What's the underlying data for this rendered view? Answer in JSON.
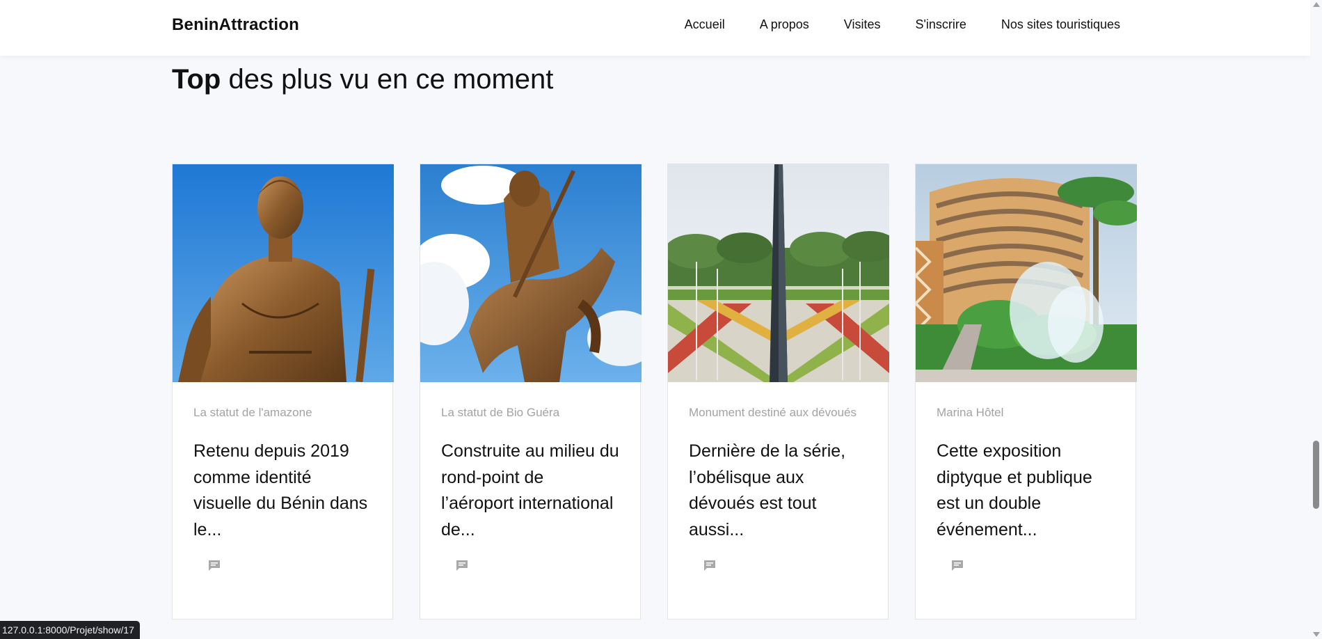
{
  "navbar": {
    "brand": "BeninAttraction",
    "links": [
      "Accueil",
      "A propos",
      "Visites",
      "S'inscrire",
      "Nos sites touristiques"
    ]
  },
  "section": {
    "title_bold": "Top",
    "title_rest": " des plus vu en ce moment"
  },
  "cards": [
    {
      "category": "La statut de l'amazone",
      "text": "Retenu depuis 2019 comme identité visuelle du Bénin dans le...",
      "image_icon": "amazone-statue-image",
      "comment_icon": "comment-icon"
    },
    {
      "category": "La statut de Bio Guéra",
      "text": "Construite au milieu du rond-point de l’aéroport international de...",
      "image_icon": "bio-guera-statue-image",
      "comment_icon": "comment-icon"
    },
    {
      "category": "Monument destiné aux dévoués",
      "text": "Dernière de la série, l’obélisque aux dévoués est tout aussi...",
      "image_icon": "obelisk-monument-image",
      "comment_icon": "comment-icon"
    },
    {
      "category": "Marina Hôtel",
      "text": "Cette exposition diptyque et publique est un double événement...",
      "image_icon": "marina-hotel-image",
      "comment_icon": "comment-icon"
    }
  ],
  "status_bar": {
    "url": "127.0.0.1:8000/Projet/show/17"
  },
  "colors": {
    "background": "#f7f8fc",
    "card_bg": "#ffffff",
    "category_text": "#a3a3a3",
    "body_text": "#111111"
  }
}
